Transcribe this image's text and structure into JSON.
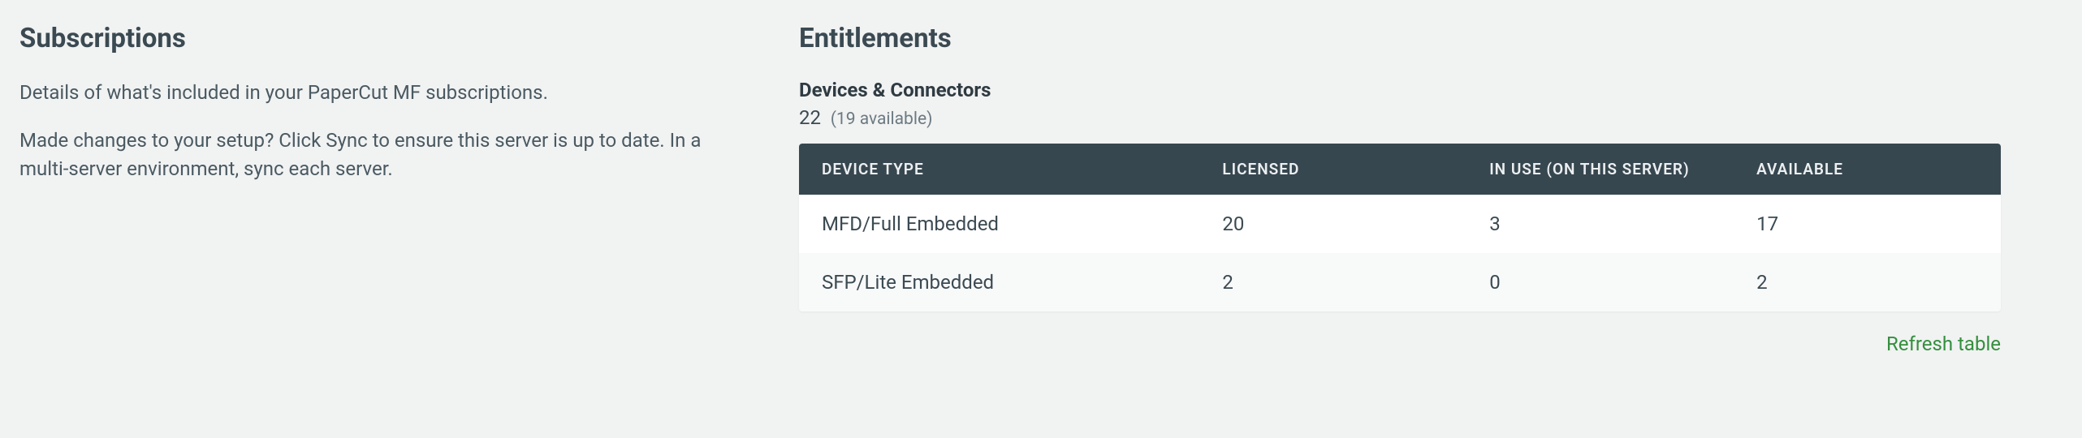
{
  "subscriptions": {
    "heading": "Subscriptions",
    "description": "Details of what's included in your PaperCut MF subscriptions.",
    "sync_hint": "Made changes to your setup? Click Sync to ensure this server is up to date. In a multi-server environment, sync each server."
  },
  "entitlements": {
    "heading": "Entitlements",
    "devices_connectors": {
      "title": "Devices & Connectors",
      "total": "22",
      "available_text": "(19 available)"
    },
    "table": {
      "headers": {
        "device_type": "DEVICE TYPE",
        "licensed": "LICENSED",
        "in_use": "IN USE (ON THIS SERVER)",
        "available": "AVAILABLE"
      },
      "rows": [
        {
          "device_type": "MFD/Full Embedded",
          "licensed": "20",
          "in_use": "3",
          "available": "17"
        },
        {
          "device_type": "SFP/Lite Embedded",
          "licensed": "2",
          "in_use": "0",
          "available": "2"
        }
      ]
    },
    "refresh_label": "Refresh table"
  }
}
